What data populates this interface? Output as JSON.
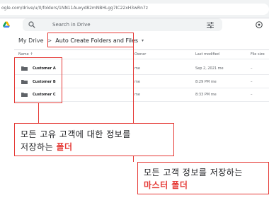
{
  "browser": {
    "url": "ogle.com/drive/u/0/folders/1NN11Auxyd82mNBHLgg7IC22xH3wRn7z"
  },
  "drive": {
    "search_placeholder": "Search in Drive",
    "breadcrumb": {
      "root": "My Drive",
      "separator": ">",
      "current": "Auto Create Folders and Files",
      "caret": "▾"
    },
    "columns": {
      "name": "Name ↑",
      "owner": "Owner",
      "modified": "Last modified",
      "size": "File size"
    },
    "rows": [
      {
        "name": "Customer A",
        "owner": "me",
        "modified": "Sep 2, 2021 me",
        "size": "–"
      },
      {
        "name": "Customer B",
        "owner": "me",
        "modified": "8:29 PM me",
        "size": "–"
      },
      {
        "name": "Customer C",
        "owner": "me",
        "modified": "8:33 PM me",
        "size": "–"
      }
    ]
  },
  "annotations": {
    "callout_1": {
      "line_1": "모든 고유 고객에 대한 정보를",
      "line_2_prefix": "저장하는 ",
      "line_2_highlight": "폴더"
    },
    "callout_2": {
      "line_1": "모든 고객 정보를 저장하는",
      "line_2": "마스터 폴더"
    }
  },
  "colors": {
    "accent_red": "#e53935",
    "text_dark": "#202124",
    "text_muted": "#5f6368"
  }
}
